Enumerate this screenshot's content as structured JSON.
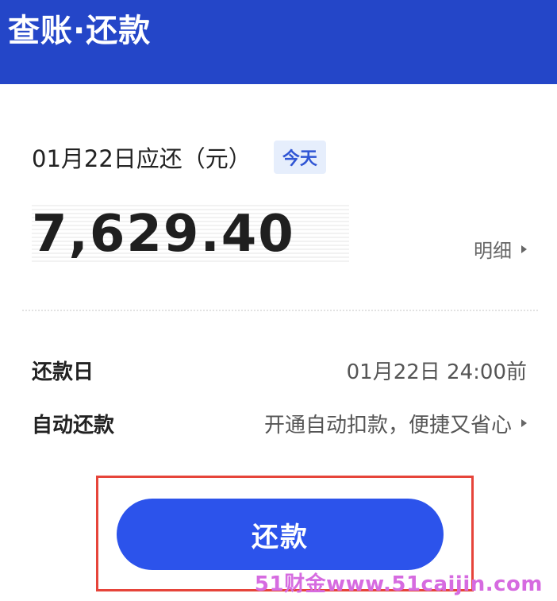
{
  "header": {
    "title": "查账·还款",
    "bg_color": "#2446c8"
  },
  "bill": {
    "due_label": "01月22日应还（元）",
    "today_badge": "今天",
    "amount": "7,629.40",
    "detail_link": "明细"
  },
  "info": {
    "repay_day_label": "还款日",
    "repay_day_value": "01月22日 24:00前",
    "auto_repay_label": "自动还款",
    "auto_repay_value": "开通自动扣款，便捷又省心"
  },
  "actions": {
    "repay_button": "还款",
    "button_color": "#2c53eb"
  },
  "watermark": "51财金www.51caijin.com"
}
